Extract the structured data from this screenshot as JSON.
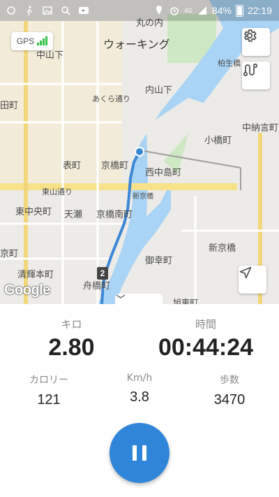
{
  "status_bar": {
    "battery": "84%",
    "time": "22:19",
    "network": "4G"
  },
  "map": {
    "gps_label": "GPS",
    "labels": [
      "丸の内",
      "ウォーキング",
      "中山下",
      "あくら通り",
      "内山下",
      "柏生橋",
      "田町",
      "中納言町",
      "小橋町",
      "表町",
      "京橋町",
      "西中島町",
      "東山通り",
      "新京橋",
      "東中央町",
      "天瀬",
      "京橋南町",
      "新京橋",
      "京町",
      "御幸町",
      "清輝本町",
      "舟橋町",
      "旭東町"
    ],
    "route_marker": "2",
    "attribution": "Google"
  },
  "stats": {
    "distance": {
      "label": "キロ",
      "value": "2.80"
    },
    "time": {
      "label": "時間",
      "value": "00:44:24"
    },
    "calories": {
      "label": "カロリー",
      "value": "121"
    },
    "speed": {
      "label": "Km/h",
      "value": "3.8"
    },
    "steps": {
      "label": "歩数",
      "value": "3470"
    }
  },
  "colors": {
    "accent": "#2f86d8",
    "river": "#a9d4f5",
    "route": "#3b87d6"
  }
}
